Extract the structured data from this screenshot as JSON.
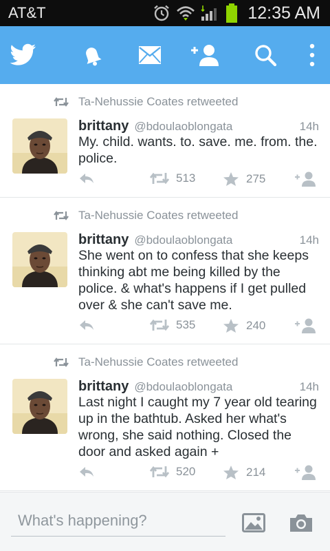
{
  "status_bar": {
    "carrier": "AT&T",
    "time": "12:35 AM"
  },
  "nav": {
    "icons": [
      "twitter-bird-icon",
      "notifications-bell-icon",
      "messages-envelope-icon",
      "add-user-icon",
      "search-icon",
      "overflow-menu-icon"
    ]
  },
  "tweets": [
    {
      "retweeted_by": "Ta-Nehussie Coates retweeted",
      "name": "brittany",
      "handle": "@bdoulaoblongata",
      "time": "14h",
      "text": "My. child. wants. to. save. me. from. the. police.",
      "retweets": "513",
      "favorites": "275"
    },
    {
      "retweeted_by": "Ta-Nehussie Coates retweeted",
      "name": "brittany",
      "handle": "@bdoulaoblongata",
      "time": "14h",
      "text": "She went on to confess that she keeps thinking abt me being killed by the police. & what's happens if I get pulled over & she can't save me.",
      "retweets": "535",
      "favorites": "240"
    },
    {
      "retweeted_by": "Ta-Nehussie Coates retweeted",
      "name": "brittany",
      "handle": "@bdoulaoblongata",
      "time": "14h",
      "text": "Last night I caught my 7 year old tearing up in the bathtub. Asked her what's wrong, she said nothing. Closed the door and asked again +",
      "retweets": "520",
      "favorites": "214"
    }
  ],
  "compose": {
    "placeholder": "What's happening?"
  },
  "colors": {
    "brand": "#55acee",
    "status_bar": "#0d0d0d",
    "battery": "#8fd400",
    "text_primary": "#292f33",
    "text_secondary": "#8a9299",
    "icon_gray": "#b8c0c6"
  }
}
